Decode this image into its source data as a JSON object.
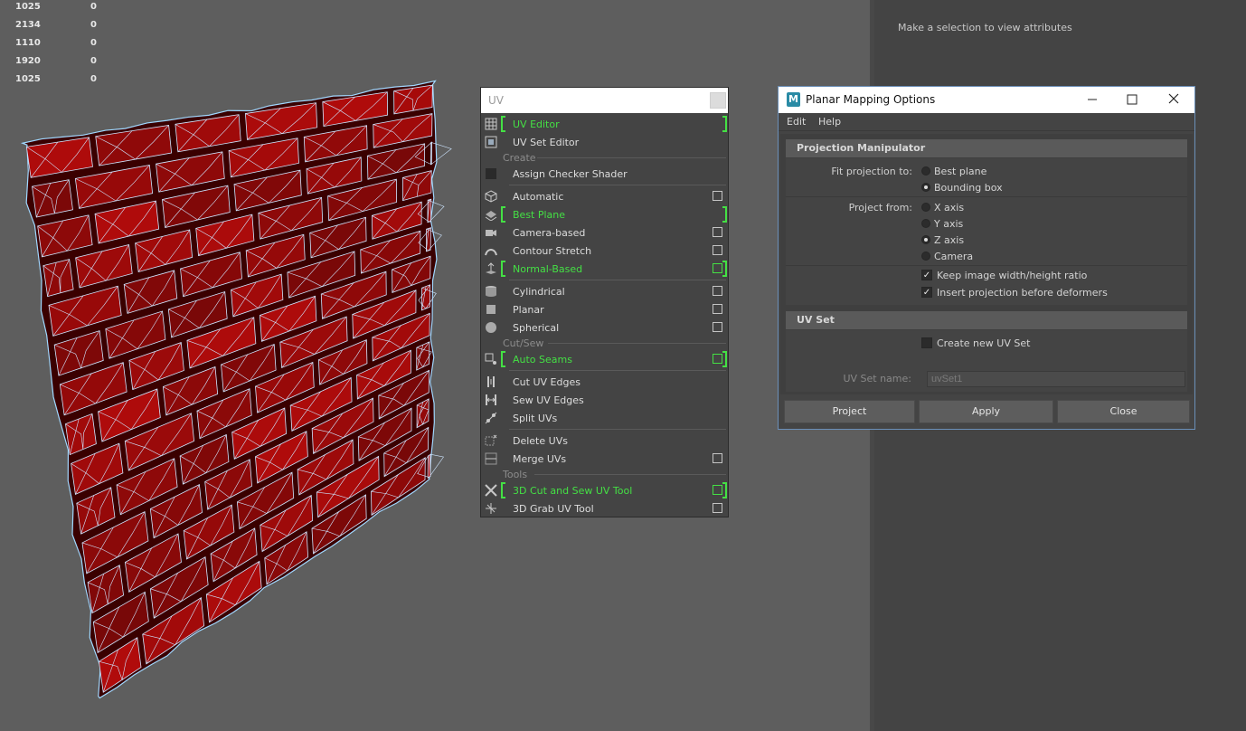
{
  "hud": {
    "rows": [
      {
        "a": "1025",
        "b": "0"
      },
      {
        "a": "2134",
        "b": "0"
      },
      {
        "a": "1110",
        "b": "0"
      },
      {
        "a": "1920",
        "b": "0"
      },
      {
        "a": "1025",
        "b": "0"
      }
    ]
  },
  "attribute_editor": {
    "message": "Make a selection to view attributes"
  },
  "uv_menu": {
    "title": "UV",
    "items": {
      "uv_editor": "UV Editor",
      "uv_set_editor": "UV Set Editor",
      "section_create": "Create",
      "assign_checker": "Assign Checker Shader",
      "automatic": "Automatic",
      "best_plane": "Best Plane",
      "camera_based": "Camera-based",
      "contour_stretch": "Contour Stretch",
      "normal_based": "Normal-Based",
      "cylindrical": "Cylindrical",
      "planar": "Planar",
      "spherical": "Spherical",
      "section_cutsew": "Cut/Sew",
      "auto_seams": "Auto Seams",
      "cut_uv_edges": "Cut UV Edges",
      "sew_uv_edges": "Sew UV Edges",
      "split_uvs": "Split UVs",
      "delete_uvs": "Delete UVs",
      "merge_uvs": "Merge UVs",
      "section_tools": "Tools",
      "cut_sew_tool": "3D Cut and Sew UV Tool",
      "grab_uv_tool": "3D Grab UV Tool"
    },
    "highlight_color": "#44e044"
  },
  "planar_dialog": {
    "title": "Planar Mapping Options",
    "menu": {
      "edit": "Edit",
      "help": "Help"
    },
    "projection_manipulator": {
      "header": "Projection Manipulator",
      "fit_label": "Fit projection to:",
      "fit_options": [
        "Best plane",
        "Bounding box"
      ],
      "fit_selected": "Bounding box",
      "from_label": "Project from:",
      "from_options": [
        "X axis",
        "Y axis",
        "Z axis",
        "Camera"
      ],
      "from_selected": "Z axis",
      "keep_ratio": "Keep image width/height ratio",
      "keep_ratio_checked": true,
      "insert_before": "Insert projection before deformers",
      "insert_before_checked": true
    },
    "uv_set": {
      "header": "UV Set",
      "create_new": "Create new UV Set",
      "create_new_checked": false,
      "name_label": "UV Set name:",
      "name_value": "uvSet1"
    },
    "buttons": {
      "project": "Project",
      "apply": "Apply",
      "close": "Close"
    }
  }
}
